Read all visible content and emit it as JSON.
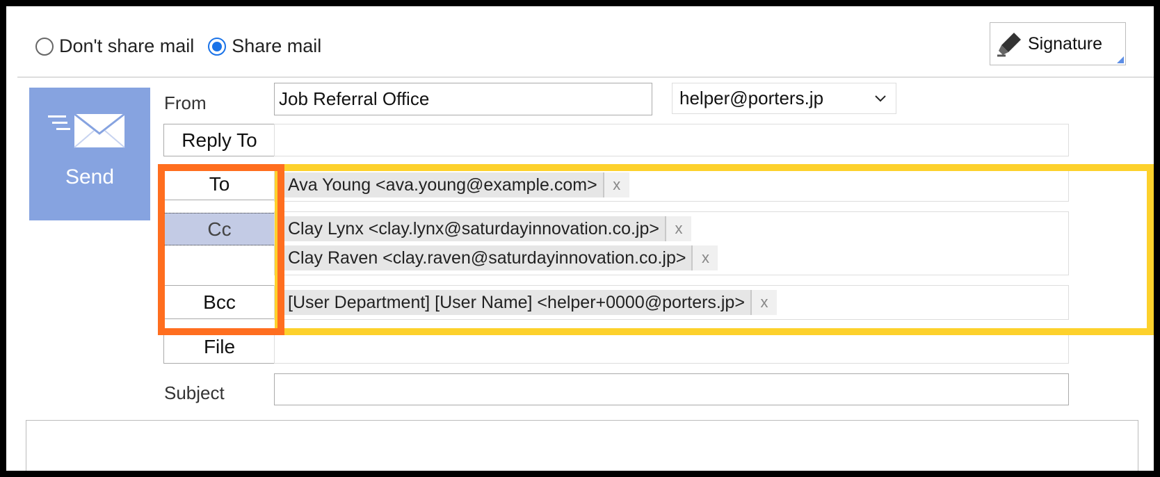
{
  "sharing": {
    "options": [
      {
        "label": "Don't share mail",
        "checked": false
      },
      {
        "label": "Share mail",
        "checked": true
      }
    ]
  },
  "signature_button": {
    "label": "Signature",
    "icon": "pen-icon"
  },
  "send_button": {
    "label": "Send",
    "icon": "envelope-icon"
  },
  "from": {
    "label": "From",
    "name": "Job Referral Office",
    "address": "helper@porters.jp"
  },
  "reply_to": {
    "label": "Reply To"
  },
  "to": {
    "label": "To",
    "recipients": [
      "Ava Young <ava.young@example.com>"
    ]
  },
  "cc": {
    "label": "Cc",
    "recipients": [
      "Clay Lynx <clay.lynx@saturdayinnovation.co.jp>",
      "Clay Raven <clay.raven@saturdayinnovation.co.jp>"
    ]
  },
  "bcc": {
    "label": "Bcc",
    "recipients": [
      "[User Department] [User Name] <helper+0000@porters.jp>"
    ]
  },
  "file": {
    "label": "File"
  },
  "subject": {
    "label": "Subject",
    "value": ""
  },
  "chip_remove_symbol": "x",
  "colors": {
    "send_bg": "#86a3e0",
    "highlight_orange": "#ff6e1f",
    "highlight_yellow": "#fdd12c",
    "radio_accent": "#1a73e8"
  }
}
